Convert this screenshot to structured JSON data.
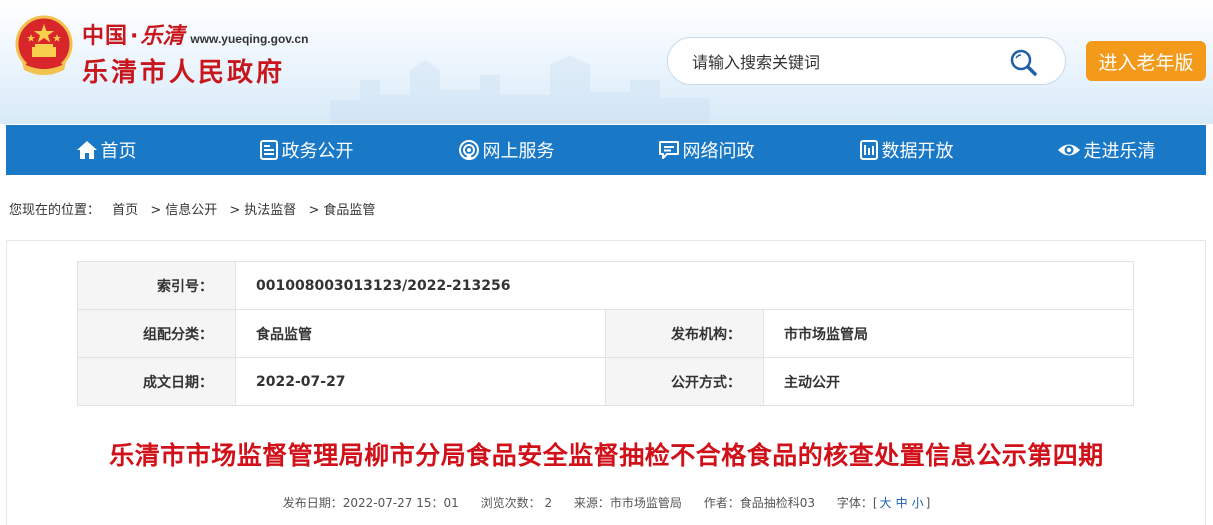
{
  "header": {
    "logo_country": "中国",
    "logo_dot": "·",
    "logo_city_script": "乐清",
    "logo_url": "www.yueqing.gov.cn",
    "logo_title": "乐清市人民政府",
    "search_placeholder": "请输入搜索关键词",
    "elder_button": "进入老年版"
  },
  "nav": {
    "items": [
      {
        "label": "首页",
        "icon": "home-icon"
      },
      {
        "label": "政务公开",
        "icon": "document-icon"
      },
      {
        "label": "网上服务",
        "icon": "signal-icon"
      },
      {
        "label": "网络问政",
        "icon": "chat-icon"
      },
      {
        "label": "数据开放",
        "icon": "data-icon"
      },
      {
        "label": "走进乐清",
        "icon": "eye-icon"
      }
    ]
  },
  "breadcrumb": {
    "prefix": "您现在的位置：",
    "items": [
      "首页",
      "信息公开",
      "执法监督",
      "食品监管"
    ],
    "separator": ">"
  },
  "meta": {
    "index_label": "索引号：",
    "index_value": "001008003013123/2022-213256",
    "category_label": "组配分类：",
    "category_value": "食品监管",
    "publisher_label": "发布机构：",
    "publisher_value": "市市场监管局",
    "date_label": "成文日期：",
    "date_value": "2022-07-27",
    "disclosure_label": "公开方式：",
    "disclosure_value": "主动公开"
  },
  "article": {
    "title": "乐清市市场监督管理局柳市分局食品安全监督抽检不合格食品的核查处置信息公示第四期",
    "publish_date": "发布日期：2022-07-27 15：01",
    "views": "浏览次数： 2",
    "source": "来源：市市场监管局",
    "author": "作者：食品抽检科03",
    "font_label": "字体：[",
    "font_large": "大",
    "font_medium": "中",
    "font_small": "小",
    "font_close": "]"
  },
  "colors": {
    "nav_bg": "#1a79c6",
    "title_red": "#d1111a",
    "elder_orange": "#f39a1a",
    "logo_red": "#c8161d"
  }
}
